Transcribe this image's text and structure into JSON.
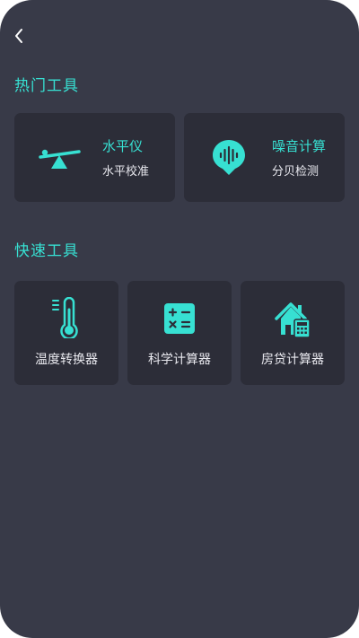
{
  "nav": {
    "back_icon": "chevron-left-icon"
  },
  "sections": {
    "hot": {
      "title": "热门工具",
      "items": [
        {
          "title": "水平仪",
          "subtitle": "水平校准",
          "icon": "seesaw-icon"
        },
        {
          "title": "噪音计算",
          "subtitle": "分贝检测",
          "icon": "sound-wave-icon"
        }
      ]
    },
    "quick": {
      "title": "快速工具",
      "items": [
        {
          "label": "温度转换器",
          "icon": "thermometer-icon"
        },
        {
          "label": "科学计算器",
          "icon": "calculator-icon"
        },
        {
          "label": "房贷计算器",
          "icon": "house-calculator-icon"
        }
      ]
    }
  },
  "colors": {
    "accent": "#37e0d2",
    "background": "#383a48",
    "card": "#2c2d38"
  }
}
